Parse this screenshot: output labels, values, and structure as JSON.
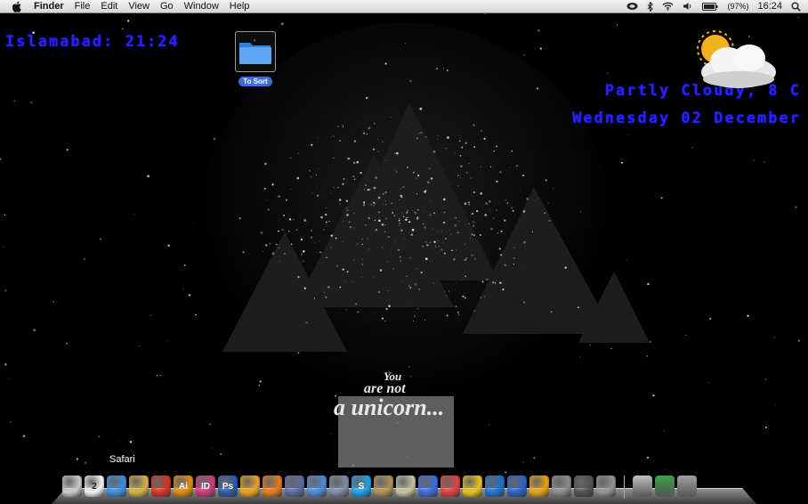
{
  "menubar": {
    "app": "Finder",
    "menus": [
      "File",
      "Edit",
      "View",
      "Go",
      "Window",
      "Help"
    ],
    "battery": "(97%)",
    "clock": "16:24",
    "icons": [
      "apple-icon",
      "sync-icon",
      "bluetooth-icon",
      "wifi-icon",
      "volume-icon",
      "battery-icon",
      "spotlight-icon"
    ]
  },
  "desktop": {
    "clock_widget": "Islamabad: 21:24",
    "weather_line": "Partly Cloudy, 8 C",
    "date_line": "Wednesday 02 December",
    "folder_label": "To Sort",
    "tagline": {
      "l1": "You",
      "l2": "are not",
      "l3": "a unicorn..."
    }
  },
  "dock": {
    "tooltip": "Safari",
    "items": [
      {
        "name": "finder",
        "glyph": "",
        "color": "#c8c8c8"
      },
      {
        "name": "ical",
        "glyph": "2",
        "color": "#f2f2f2"
      },
      {
        "name": "safari",
        "glyph": "",
        "color": "#3a8fe0"
      },
      {
        "name": "preview",
        "glyph": "",
        "color": "#d8b040"
      },
      {
        "name": "ball-app",
        "glyph": "",
        "color": "#d83020"
      },
      {
        "name": "illustrator",
        "glyph": "Ai",
        "color": "#e08a10"
      },
      {
        "name": "indesign",
        "glyph": "ID",
        "color": "#c83a7a"
      },
      {
        "name": "photoshop",
        "glyph": "Ps",
        "color": "#2a5aa8"
      },
      {
        "name": "sketch-app",
        "glyph": "",
        "color": "#e8a020"
      },
      {
        "name": "blender",
        "glyph": "",
        "color": "#e87818"
      },
      {
        "name": "pen-app",
        "glyph": "",
        "color": "#5a6aa0"
      },
      {
        "name": "itunes",
        "glyph": "",
        "color": "#4a8ad8"
      },
      {
        "name": "quicktime",
        "glyph": "",
        "color": "#7a8aa8"
      },
      {
        "name": "skype",
        "glyph": "S",
        "color": "#1aa0e8"
      },
      {
        "name": "movie-app",
        "glyph": "",
        "color": "#b09050"
      },
      {
        "name": "star-app",
        "glyph": "",
        "color": "#c0c0a0"
      },
      {
        "name": "dvd-player",
        "glyph": "",
        "color": "#3a6ae0"
      },
      {
        "name": "game-app",
        "glyph": "",
        "color": "#e04040"
      },
      {
        "name": "radiation-app",
        "glyph": "",
        "color": "#e8c020"
      },
      {
        "name": "globe-app",
        "glyph": "",
        "color": "#1a70d0"
      },
      {
        "name": "transmit-app",
        "glyph": "",
        "color": "#2a60c8"
      },
      {
        "name": "tv-app",
        "glyph": "",
        "color": "#e8a010"
      },
      {
        "name": "utility-app",
        "glyph": "",
        "color": "#8a8a8a"
      },
      {
        "name": "camera-app",
        "glyph": "",
        "color": "#505050"
      },
      {
        "name": "settings-app",
        "glyph": "",
        "color": "#909090"
      }
    ],
    "stacks": [
      {
        "name": "applications-stack",
        "color": "#c0c0c0"
      },
      {
        "name": "downloads-stack",
        "color": "#3aa040"
      },
      {
        "name": "trash",
        "color": "#a0a0a0"
      }
    ]
  }
}
